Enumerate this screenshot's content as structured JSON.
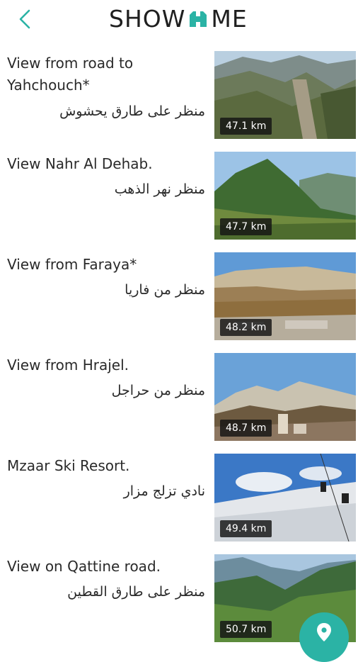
{
  "header": {
    "logo_left": "SHOW",
    "logo_right": "ME",
    "back_icon": "chevron-left-icon",
    "accent": "#2bb3a5"
  },
  "places": [
    {
      "title": "View from road to Yahchouch*",
      "arabic": "منظر على طارق يحشوش",
      "distance": "47.1 km"
    },
    {
      "title": "View Nahr Al Dehab.",
      "arabic": "منظر نهر الذهب",
      "distance": "47.7 km"
    },
    {
      "title": "View from Faraya*",
      "arabic": "منظر من فاريا",
      "distance": "48.2 km"
    },
    {
      "title": "View from Hrajel.",
      "arabic": "منظر من حراجل",
      "distance": "48.7 km"
    },
    {
      "title": "Mzaar Ski Resort.",
      "arabic": "نادي تزلج مزار",
      "distance": "49.4 km"
    },
    {
      "title": "View on Qattine road.",
      "arabic": "منظر على طارق القطين",
      "distance": "50.7 km"
    }
  ],
  "fab": {
    "icon": "map-pin-icon"
  }
}
